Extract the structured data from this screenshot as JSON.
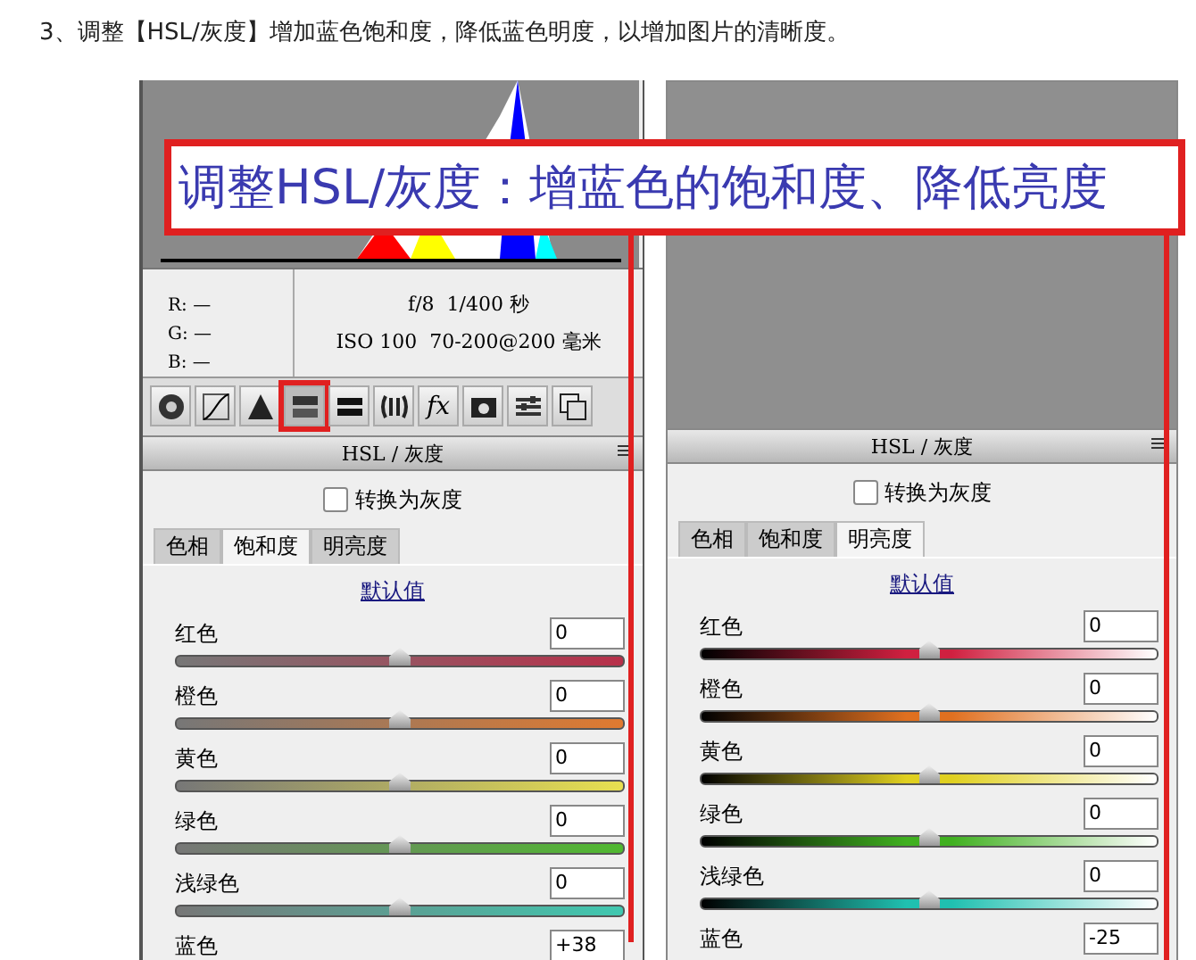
{
  "instruction": "3、调整【HSL/灰度】增加蓝色饱和度，降低蓝色明度，以增加图片的清晰度。",
  "caption": "调整HSL/灰度：增蓝色的饱和度、降低亮度",
  "left_panel": {
    "readout": [
      "R: —",
      "G: —",
      "B: —"
    ],
    "exif": [
      "f/8  1/400 秒",
      "ISO 100  70-200@200 毫米"
    ],
    "toolbar": [
      {
        "kind": "aperture",
        "selected": false
      },
      {
        "kind": "curve",
        "selected": false
      },
      {
        "kind": "triangle",
        "selected": false
      },
      {
        "kind": "hsl",
        "selected": true
      },
      {
        "kind": "split",
        "selected": false
      },
      {
        "kind": "lens",
        "selected": false
      },
      {
        "kind": "fx",
        "label": "fx",
        "selected": false
      },
      {
        "kind": "camera",
        "selected": false
      },
      {
        "kind": "sliders",
        "selected": false
      },
      {
        "kind": "presets",
        "selected": false
      }
    ],
    "title": "HSL / 灰度",
    "grayscale": {
      "label": "转换为灰度",
      "checked": false
    },
    "tabs": [
      {
        "label": "色相",
        "selected": false
      },
      {
        "label": "饱和度",
        "selected": true
      },
      {
        "label": "明亮度",
        "selected": false
      }
    ],
    "link": "默认值",
    "sliders": [
      {
        "name": "红色",
        "value": "0",
        "level": 0.5,
        "color": "#b8304a"
      },
      {
        "name": "橙色",
        "value": "0",
        "level": 0.5,
        "color": "#e07a30"
      },
      {
        "name": "黄色",
        "value": "0",
        "level": 0.5,
        "color": "#e8e050"
      },
      {
        "name": "绿色",
        "value": "0",
        "level": 0.5,
        "color": "#50b830"
      },
      {
        "name": "浅绿色",
        "value": "0",
        "level": 0.5,
        "color": "#40c8b0"
      },
      {
        "name": "蓝色",
        "value": "+38"
      }
    ]
  },
  "right_panel": {
    "title": "HSL / 灰度",
    "grayscale": {
      "label": "转换为灰度",
      "checked": false
    },
    "tabs": [
      {
        "label": "色相",
        "selected": false
      },
      {
        "label": "饱和度",
        "selected": false
      },
      {
        "label": "明亮度",
        "selected": true
      }
    ],
    "link": "默认值",
    "sliders": [
      {
        "name": "红色",
        "value": "0",
        "level": 0.5,
        "color": "#d02040"
      },
      {
        "name": "橙色",
        "value": "0",
        "level": 0.5,
        "color": "#e07020"
      },
      {
        "name": "黄色",
        "value": "0",
        "level": 0.5,
        "color": "#e0d020"
      },
      {
        "name": "绿色",
        "value": "0",
        "level": 0.5,
        "color": "#40b020"
      },
      {
        "name": "浅绿色",
        "value": "0",
        "level": 0.5,
        "color": "#20c0b0"
      },
      {
        "name": "蓝色",
        "value": "-25"
      }
    ]
  }
}
